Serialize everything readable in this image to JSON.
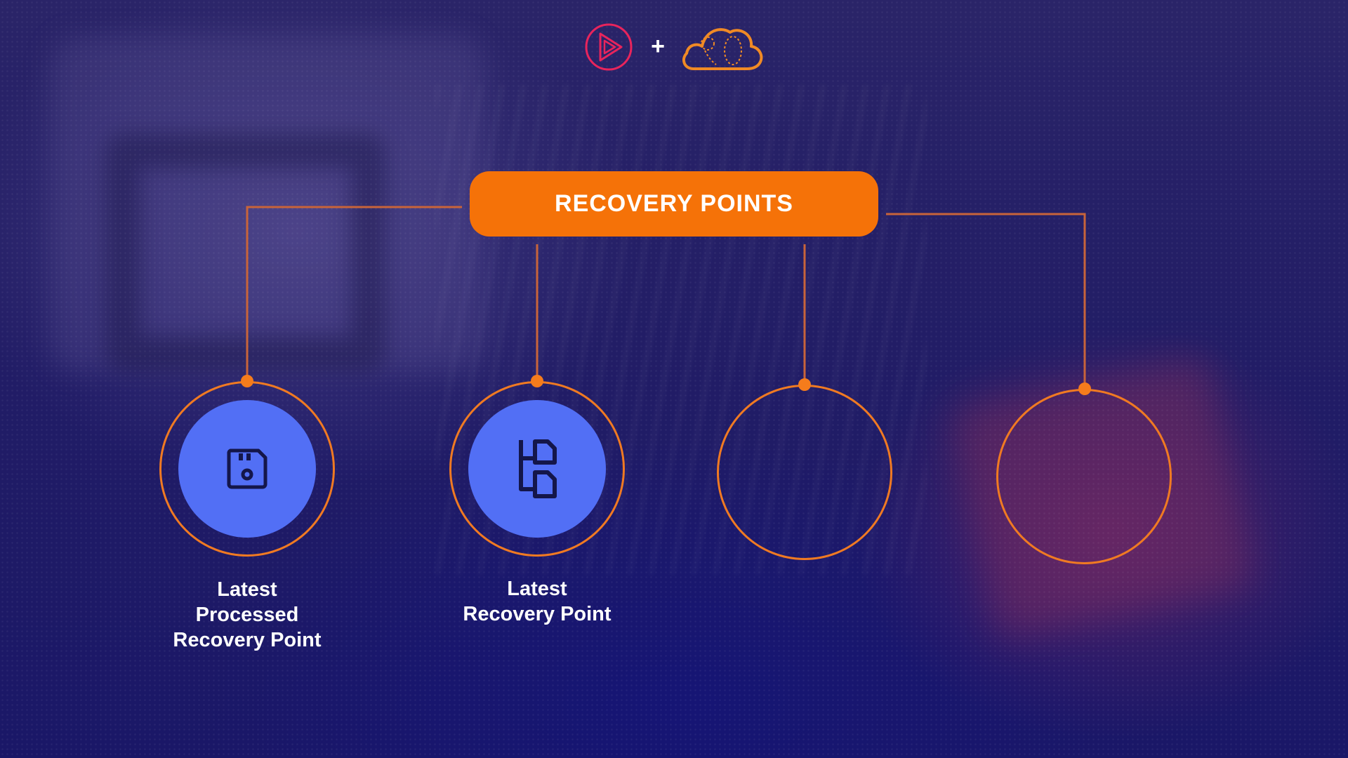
{
  "title": "RECOVERY POINTS",
  "header": {
    "left_logo_icon": "play-triangle-logo-icon",
    "separator": "+",
    "right_logo_icon": "cloud-logo-icon"
  },
  "nodes": [
    {
      "icon": "floppy-disk-icon",
      "label_lines": [
        "Latest",
        "Processed",
        "Recovery Point"
      ]
    },
    {
      "icon": "branching-documents-icon",
      "label_lines": [
        "Latest",
        "Recovery Point"
      ]
    },
    {
      "icon": "",
      "label_lines": []
    },
    {
      "icon": "",
      "label_lines": []
    }
  ],
  "colors": {
    "accent_orange": "#f57208",
    "node_fill_blue": "#526ff5",
    "connector_line": "#c8643a",
    "logo_pink": "#e8245c",
    "logo_orange": "#f08a25"
  }
}
